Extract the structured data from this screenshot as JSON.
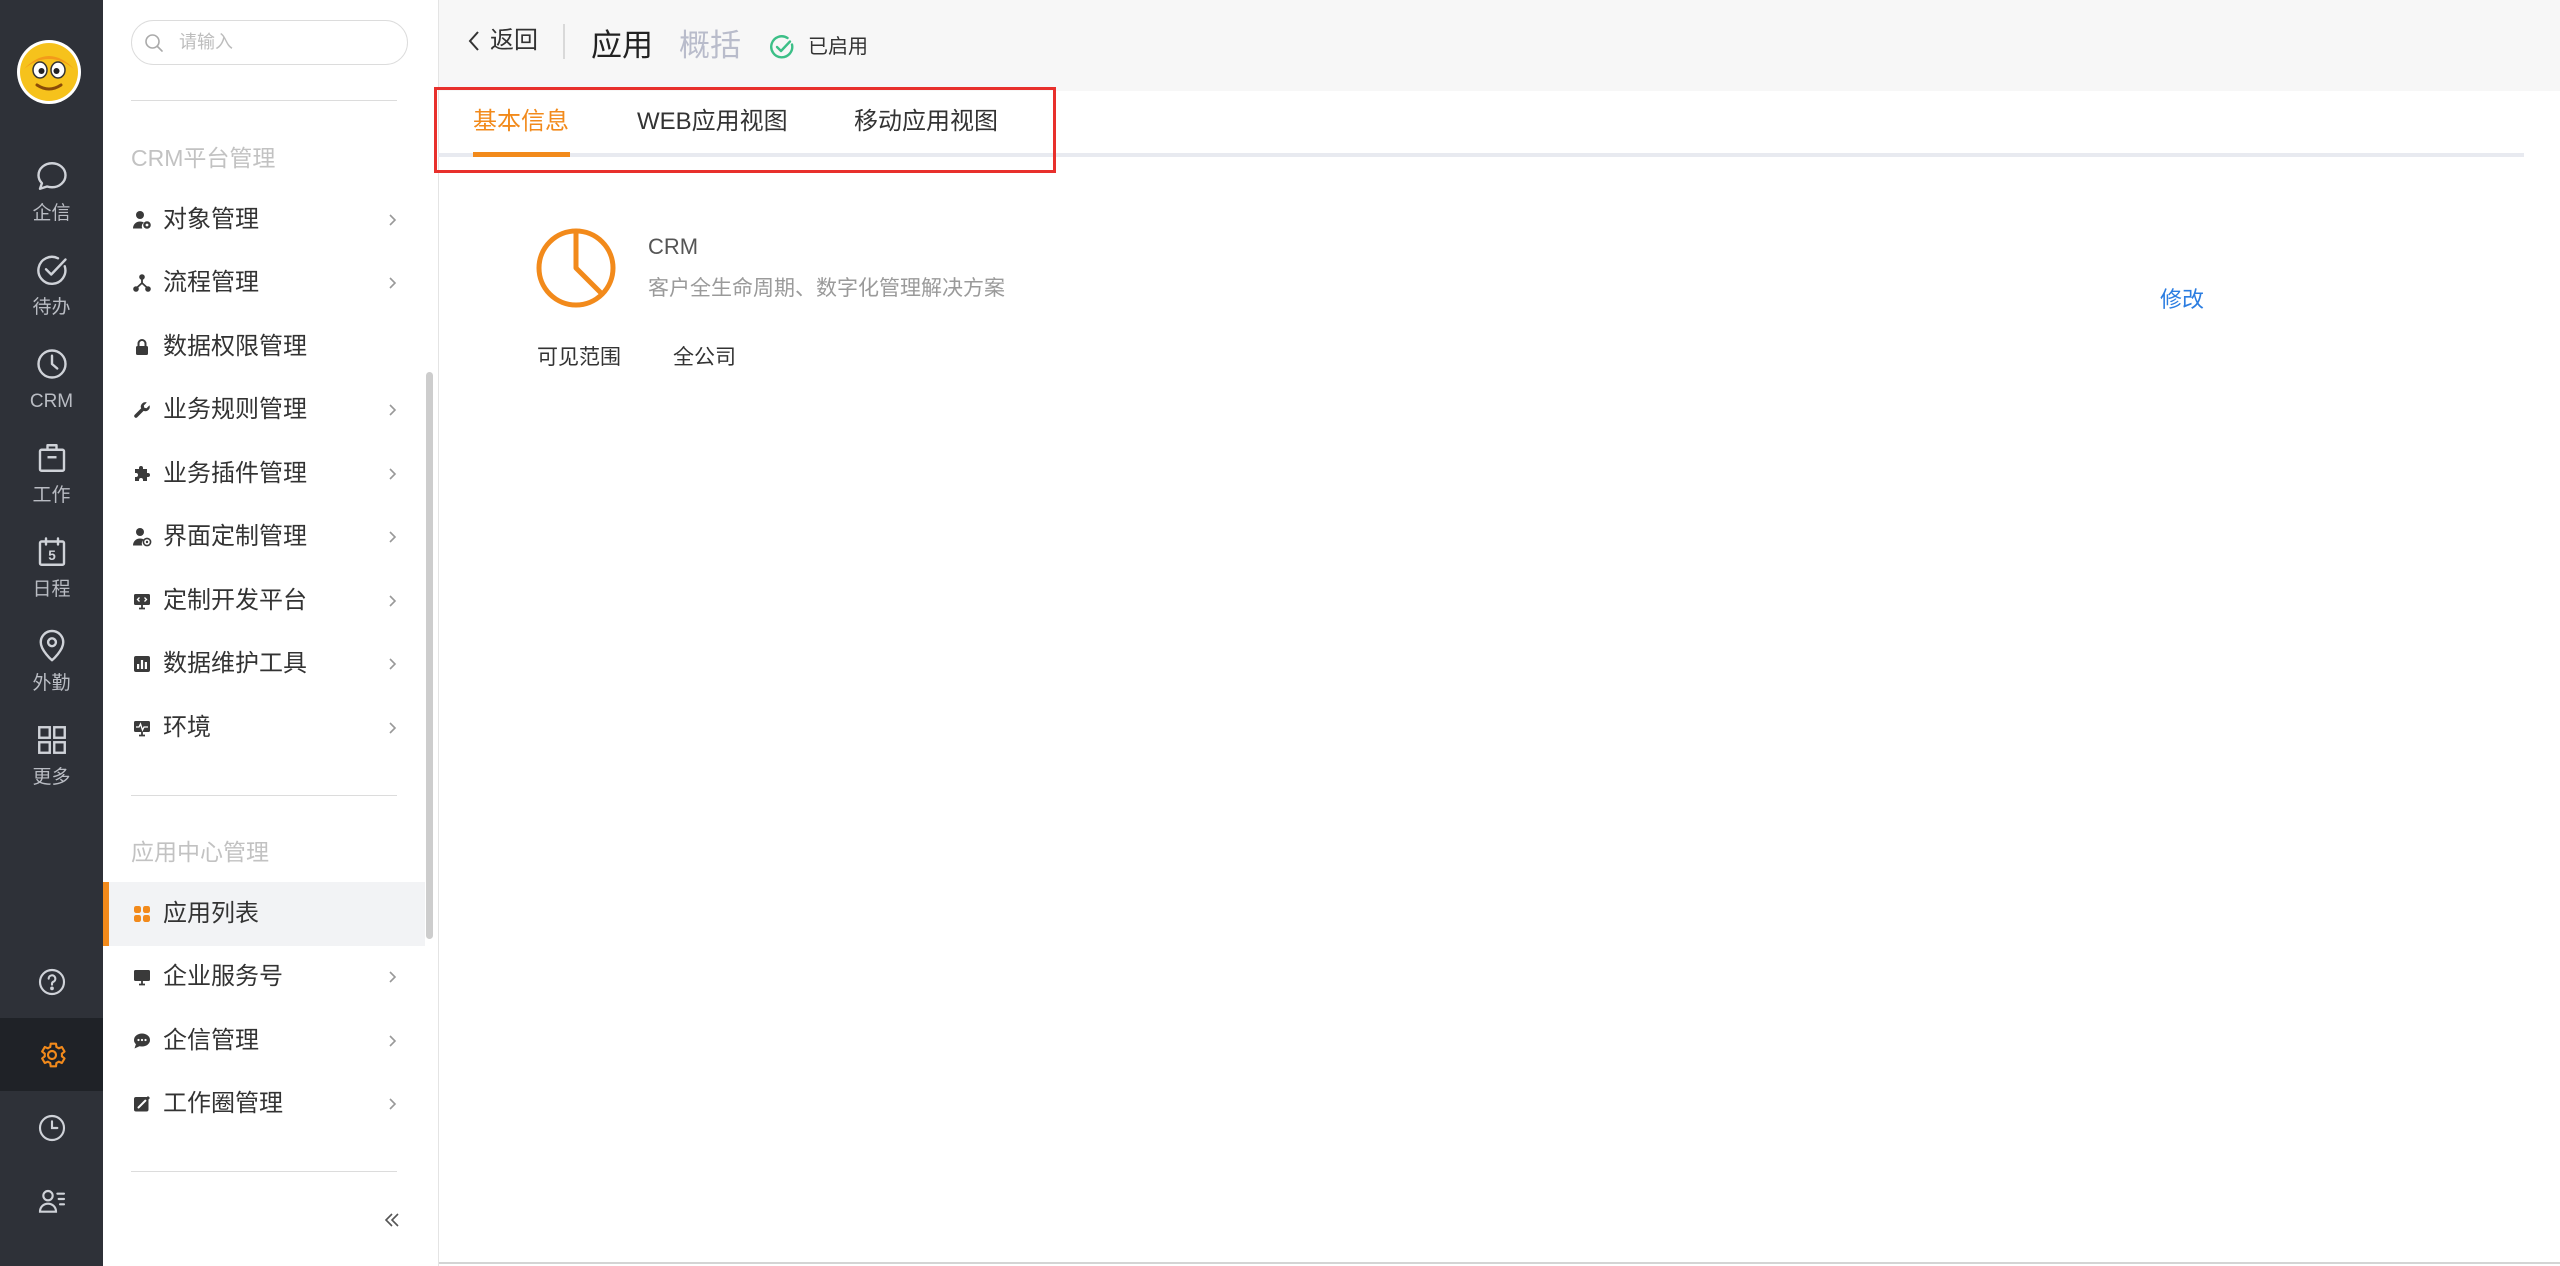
{
  "colors": {
    "nav_background": "#2e3138",
    "accent": "#f28a1b",
    "link": "#2b7de1",
    "status_enabled": "#3cbf87",
    "highlight_box": "#e8302c"
  },
  "nav": {
    "avatar_icon": "cartoon-avatar",
    "items": [
      {
        "label": "企信",
        "icon": "chat-bubble-icon"
      },
      {
        "label": "待办",
        "icon": "check-circle-icon"
      },
      {
        "label": "CRM",
        "icon": "clock-icon"
      },
      {
        "label": "工作",
        "icon": "briefcase-icon"
      },
      {
        "label": "日程",
        "icon": "calendar-icon",
        "icon_text": "5"
      },
      {
        "label": "外勤",
        "icon": "location-pin-icon"
      },
      {
        "label": "更多",
        "icon": "grid-icon"
      }
    ],
    "bottom_items": [
      {
        "icon": "help-icon",
        "active": false
      },
      {
        "icon": "gear-icon",
        "active": true
      },
      {
        "icon": "history-icon",
        "active": false
      },
      {
        "icon": "user-list-icon",
        "active": false
      }
    ]
  },
  "sidebar": {
    "search": {
      "placeholder": "请输入",
      "icon": "search-icon"
    },
    "sections": [
      {
        "title": "CRM平台管理",
        "items": [
          {
            "label": "对象管理",
            "icon": "user-gear-icon",
            "has_submenu": true
          },
          {
            "label": "流程管理",
            "icon": "flow-icon",
            "has_submenu": true
          },
          {
            "label": "数据权限管理",
            "icon": "lock-icon",
            "has_submenu": false
          },
          {
            "label": "业务规则管理",
            "icon": "wrench-icon",
            "has_submenu": true
          },
          {
            "label": "业务插件管理",
            "icon": "puzzle-icon",
            "has_submenu": true
          },
          {
            "label": "界面定制管理",
            "icon": "user-palette-icon",
            "has_submenu": true
          },
          {
            "label": "定制开发平台",
            "icon": "monitor-code-icon",
            "has_submenu": true
          },
          {
            "label": "数据维护工具",
            "icon": "bar-chart-icon",
            "has_submenu": true
          },
          {
            "label": "环境",
            "icon": "monitor-pulse-icon",
            "has_submenu": true
          }
        ]
      },
      {
        "title": "应用中心管理",
        "items": [
          {
            "label": "应用列表",
            "icon": "app-grid-icon",
            "has_submenu": false,
            "active": true
          },
          {
            "label": "企业服务号",
            "icon": "monitor-icon",
            "has_submenu": true
          },
          {
            "label": "企信管理",
            "icon": "chat-icon",
            "has_submenu": true
          },
          {
            "label": "工作圈管理",
            "icon": "edit-square-icon",
            "has_submenu": true
          }
        ]
      }
    ],
    "collapse_icon": "double-chevron-left-icon"
  },
  "header": {
    "back_icon": "chevron-left-icon",
    "back_label": "返回",
    "title": "应用",
    "subtitle": "概括",
    "status_icon": "check-circle-icon",
    "status_label": "已启用"
  },
  "tabs": [
    {
      "label": "基本信息",
      "active": true
    },
    {
      "label": "WEB应用视图",
      "active": false
    },
    {
      "label": "移动应用视图",
      "active": false
    }
  ],
  "app_info": {
    "icon": "pie-chart-icon",
    "name": "CRM",
    "description": "客户全生命周期、数字化管理解决方案",
    "edit_label": "修改",
    "visibility_label": "可见范围",
    "visibility_value": "全公司"
  }
}
